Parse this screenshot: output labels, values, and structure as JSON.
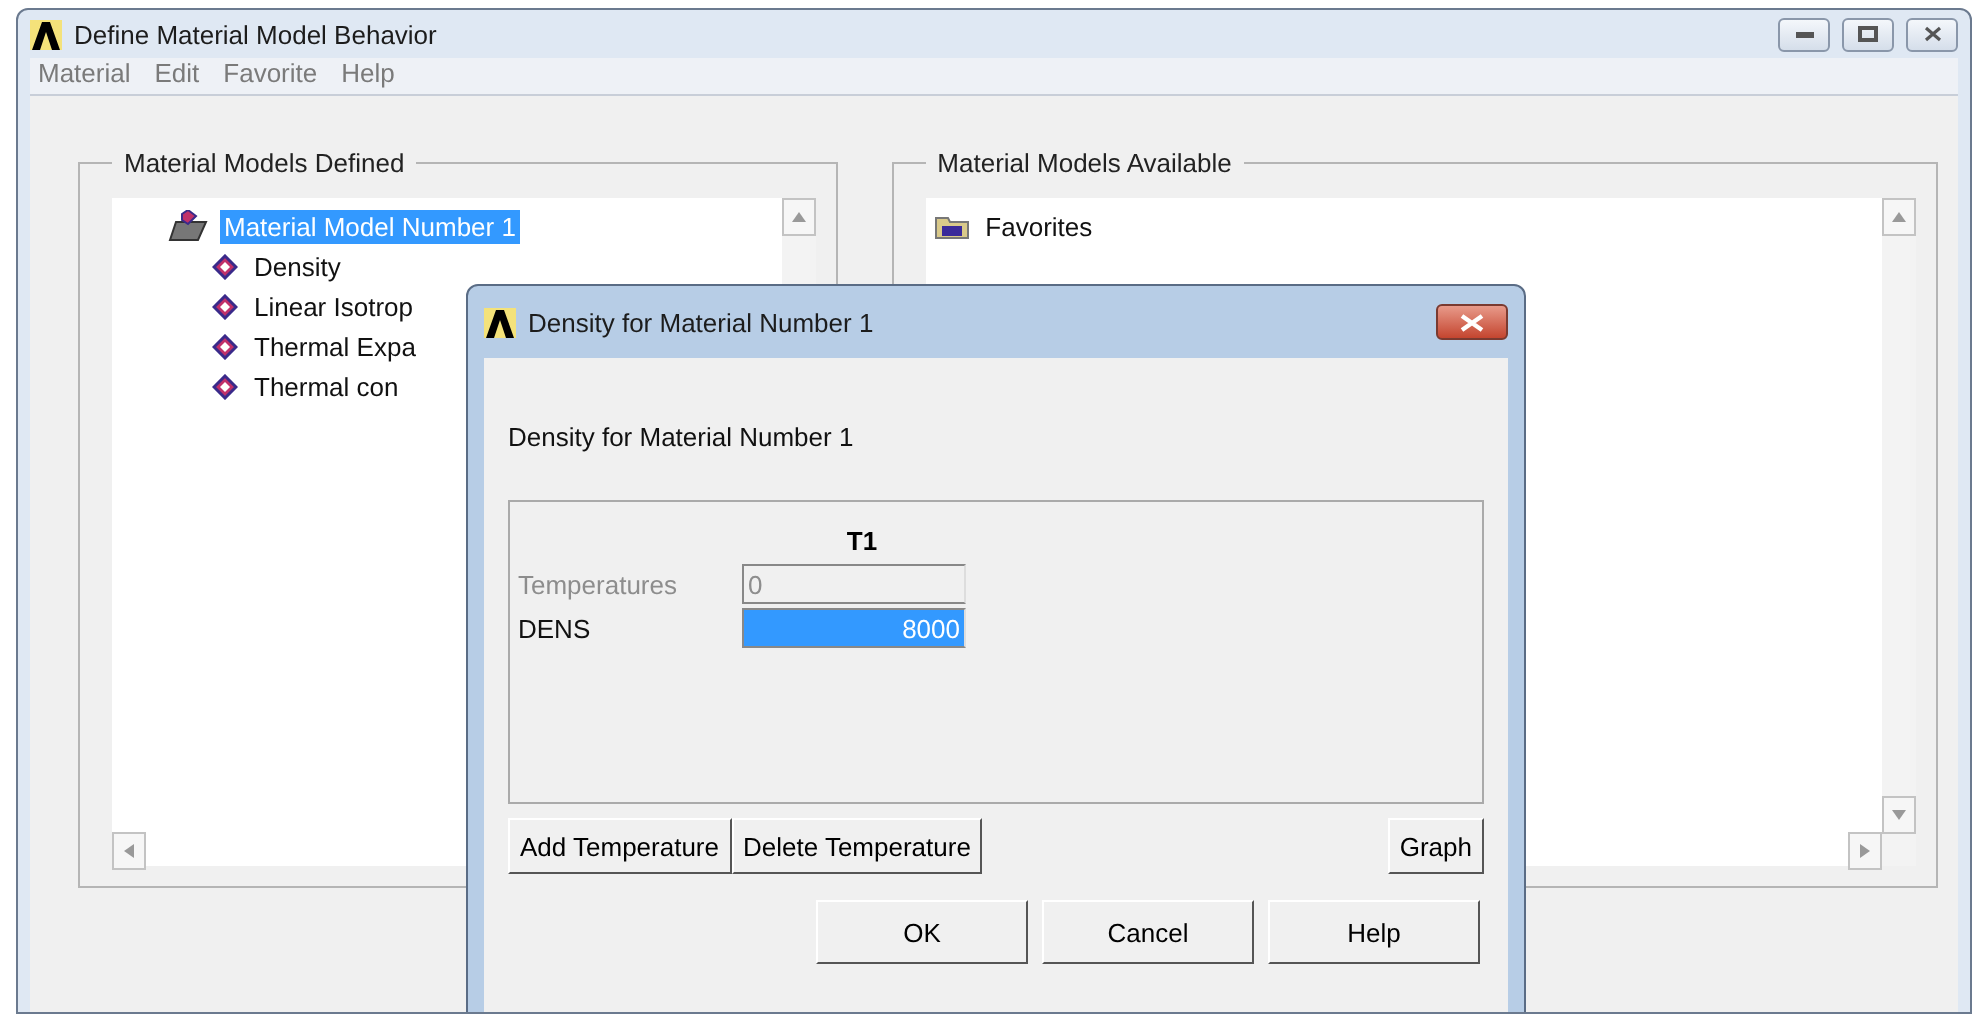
{
  "window": {
    "title": "Define Material Model Behavior"
  },
  "menu": [
    "Material",
    "Edit",
    "Favorite",
    "Help"
  ],
  "defined": {
    "title": "Material Models Defined",
    "root": {
      "label": "Material Model Number 1",
      "selected": true,
      "children": [
        {
          "label": "Density"
        },
        {
          "label": "Linear Isotrop"
        },
        {
          "label": "Thermal Expa"
        },
        {
          "label": "Thermal con"
        }
      ]
    }
  },
  "available": {
    "title": "Material Models Available",
    "items": [
      {
        "label": "Favorites"
      }
    ]
  },
  "dialog": {
    "title": "Density for Material Number 1",
    "heading": "Density for Material Number 1",
    "column": "T1",
    "rows": [
      {
        "label": "Temperatures",
        "value": "0",
        "disabled": true,
        "selected": false
      },
      {
        "label": "DENS",
        "value": "8000",
        "disabled": false,
        "selected": true
      }
    ],
    "table_buttons": [
      "Add Temperature",
      "Delete Temperature",
      "Graph"
    ],
    "buttons": [
      "OK",
      "Cancel",
      "Help"
    ]
  }
}
